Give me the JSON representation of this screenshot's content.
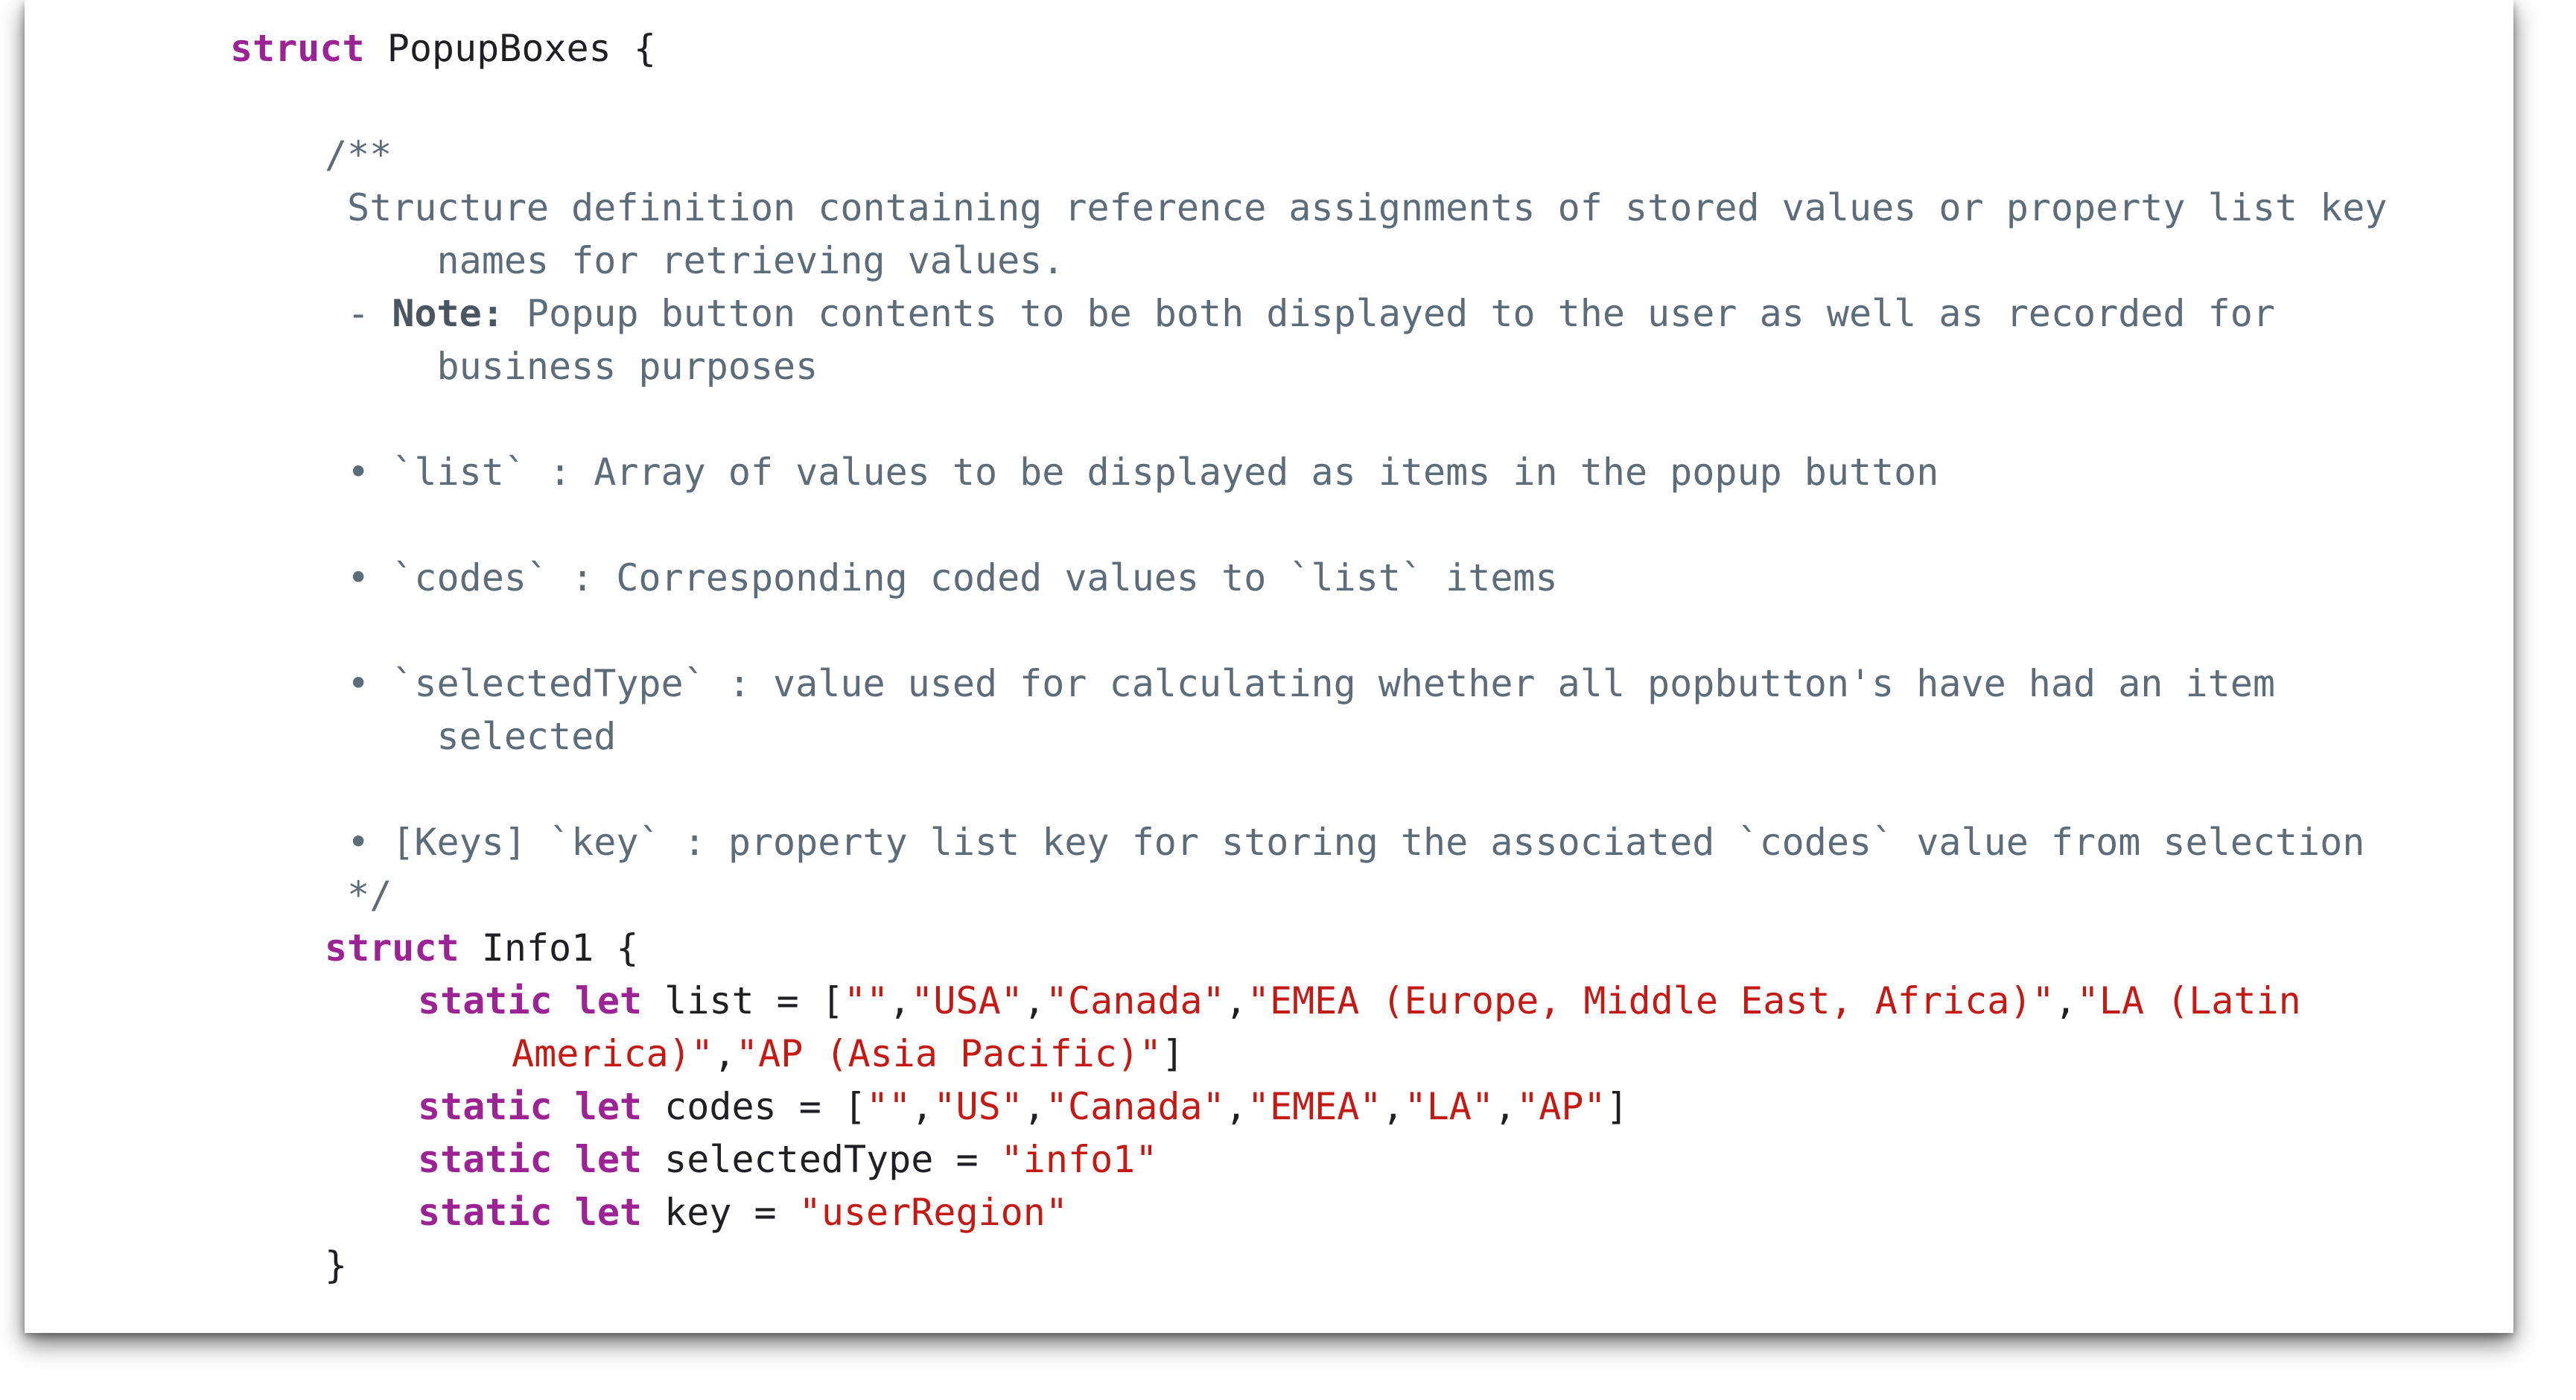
{
  "colors": {
    "keyword": "#9b2393",
    "string": "#c41a16",
    "comment": "#5d6c79",
    "plain": "#1f1f24",
    "background": "#ffffff"
  },
  "code": {
    "struct_outer": {
      "kw": "struct",
      "name": " PopupBoxes {"
    },
    "doc_open": "/**",
    "doc_desc_1": " Structure definition containing reference assignments of stored values or property list key",
    "doc_desc_2": "     names for retrieving values.",
    "doc_note_dash": " - ",
    "doc_note_label": "Note:",
    "doc_note_text": " Popup button contents to be both displayed to the user as well as recorded for",
    "doc_note_cont": "     business purposes",
    "doc_bullet_list": " • `list` : Array of values to be displayed as items in the popup button",
    "doc_bullet_codes": " • `codes` : Corresponding coded values to `list` items",
    "doc_bullet_selected_1": " • `selectedType` : value used for calculating whether all popbutton's have had an item",
    "doc_bullet_selected_2": "     selected",
    "doc_bullet_key": " • [Keys] `key` : property list key for storing the associated `codes` value from selection",
    "doc_close": " */",
    "struct_inner": {
      "kw": "struct",
      "name": " Info1 {"
    },
    "list_line": {
      "kw": "static let",
      "name": " list = [",
      "s1": "\"\"",
      "c1": ",",
      "s2": "\"USA\"",
      "c2": ",",
      "s3": "\"Canada\"",
      "c3": ",",
      "s4": "\"EMEA (Europe, Middle East, Africa)\"",
      "c4": ",",
      "s5": "\"LA (Latin"
    },
    "list_cont": {
      "s5b": "America)\"",
      "c5": ",",
      "s6": "\"AP (Asia Pacific)\"",
      "close": "]"
    },
    "codes_line": {
      "kw": "static let",
      "name": " codes = [",
      "s1": "\"\"",
      "c1": ",",
      "s2": "\"US\"",
      "c2": ",",
      "s3": "\"Canada\"",
      "c3": ",",
      "s4": "\"EMEA\"",
      "c4": ",",
      "s5": "\"LA\"",
      "c5": ",",
      "s6": "\"AP\"",
      "close": "]"
    },
    "selected_line": {
      "kw": "static let",
      "name": " selectedType = ",
      "value": "\"info1\""
    },
    "key_line": {
      "kw": "static let",
      "name": " key = ",
      "value": "\"userRegion\""
    },
    "inner_close": "}"
  }
}
